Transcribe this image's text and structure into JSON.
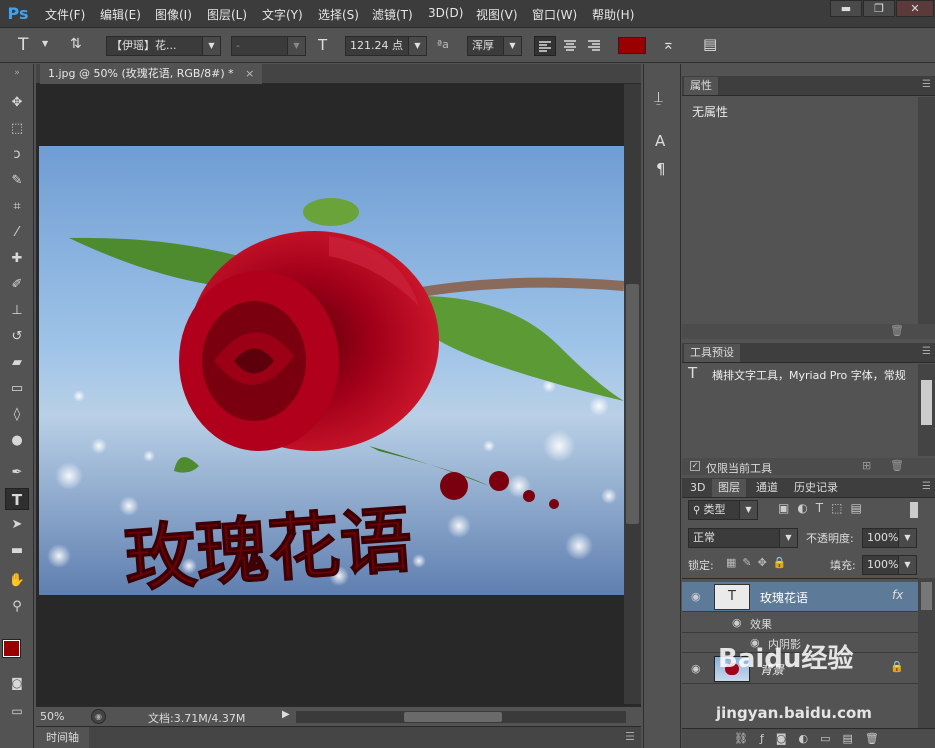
{
  "app": {
    "logo": "Ps"
  },
  "menu": [
    "文件(F)",
    "编辑(E)",
    "图像(I)",
    "图层(L)",
    "文字(Y)",
    "选择(S)",
    "滤镜(T)",
    "3D(D)",
    "视图(V)",
    "窗口(W)",
    "帮助(H)"
  ],
  "window_controls": {
    "minimize": "▬",
    "restore": "❐",
    "close": "✕"
  },
  "options": {
    "font_family": "【伊瑶】花...",
    "font_style": "-",
    "font_size": "121.24 点",
    "aa_label": "ªa",
    "antialias": "浑厚",
    "text_color": "#9a0000"
  },
  "document": {
    "tab_title": "1.jpg @ 50% (玫瑰花语, RGB/8#) *",
    "tab_close": "×",
    "canvas_text": "玫瑰花语",
    "zoom": "50%",
    "doc_size": "文档:3.71M/4.37M"
  },
  "timeline": {
    "label": "时间轴"
  },
  "properties": {
    "tab": "属性",
    "content": "无属性"
  },
  "tool_presets": {
    "tab": "工具预设",
    "item": "横排文字工具，Myriad Pro 字体，常规",
    "current_only": "仅限当前工具"
  },
  "layers_panel": {
    "tabs": [
      "3D",
      "图层",
      "通道",
      "历史记录"
    ],
    "filter": "类型",
    "blend_mode": "正常",
    "opacity_label": "不透明度:",
    "opacity": "100%",
    "lock_label": "锁定:",
    "fill_label": "填充:",
    "fill": "100%",
    "layers": [
      {
        "name": "玫瑰花语",
        "fx": "fx"
      },
      {
        "name": "背景"
      }
    ],
    "effects_label": "效果",
    "effect_inner_shadow": "内阴影"
  },
  "colors": {
    "foreground": "#9a0000",
    "background": "#ffffff",
    "accent": "#3fa3f0"
  },
  "watermark": {
    "brand": "Baidu经验",
    "url": "jingyan.baidu.com"
  }
}
